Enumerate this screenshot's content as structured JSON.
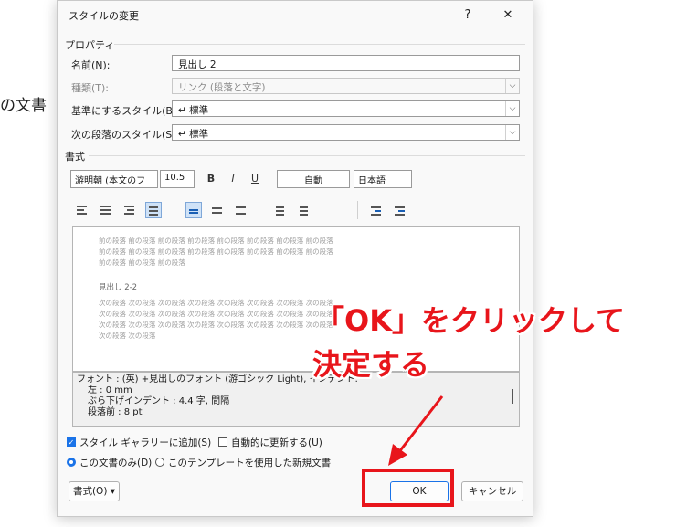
{
  "background": {
    "text": "の文書"
  },
  "dialog": {
    "title": "スタイルの変更",
    "help": "?",
    "close": "✕",
    "properties": {
      "section": "プロパティ",
      "name_label": "名前(N):",
      "name_value": "見出し 2",
      "type_label": "種類(T):",
      "type_value": "リンク (段落と文字)",
      "base_label": "基準にするスタイル(B):",
      "base_value": "↵ 標準",
      "next_label": "次の段落のスタイル(S):",
      "next_value": "↵ 標準"
    },
    "format": {
      "section": "書式",
      "font": "游明朝 (本文のフ",
      "size": "10.5",
      "bold": "B",
      "italic": "I",
      "underline": "U",
      "color": "自動",
      "language": "日本語"
    },
    "preview": {
      "prev_lines": [
        "前の段落 前の段落 前の段落 前の段落 前の段落 前の段落 前の段落 前の段落",
        "前の段落 前の段落 前の段落 前の段落 前の段落 前の段落 前の段落 前の段落",
        "前の段落 前の段落 前の段落"
      ],
      "heading": "見出し 2-2",
      "next_lines": [
        "次の段落 次の段落 次の段落 次の段落 次の段落 次の段落 次の段落 次の段落",
        "次の段落 次の段落 次の段落 次の段落 次の段落 次の段落 次の段落 次の段落",
        "次の段落 次の段落 次の段落 次の段落 次の段落 次の段落 次の段落 次の段落",
        "次の段落 次の段落"
      ]
    },
    "description": {
      "line1": "フォント : (英) +見出しのフォント (游ゴシック Light), インデント:",
      "line2": "左 : 0 mm",
      "line3": "ぶら下げインデント : 4.4 字, 間隔",
      "line4": "段落前 : 8 pt"
    },
    "options": {
      "add_gallery": "スタイル ギャラリーに追加(S)",
      "auto_update": "自動的に更新する(U)",
      "this_doc": "この文書のみ(D)",
      "template": "このテンプレートを使用した新規文書"
    },
    "buttons": {
      "format": "書式(O) ▾",
      "ok": "OK",
      "cancel": "キャンセル"
    }
  },
  "annotation": {
    "line1": "「OK」をクリックして",
    "line2": "決定する",
    "color": "#e8151b"
  }
}
